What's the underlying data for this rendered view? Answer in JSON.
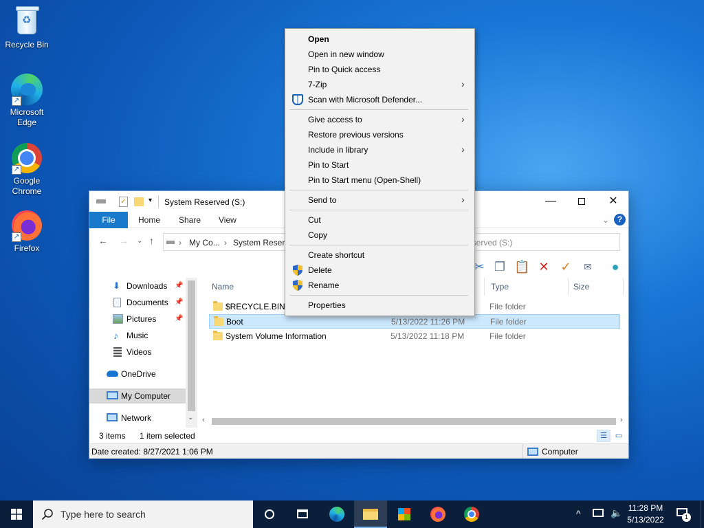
{
  "desktop": {
    "icons": [
      {
        "label": "Recycle Bin"
      },
      {
        "label": "Microsoft Edge"
      },
      {
        "label": "Google Chrome"
      },
      {
        "label": "Firefox"
      }
    ]
  },
  "explorer": {
    "title": "System Reserved (S:)",
    "ribbon_tabs": [
      "File",
      "Home",
      "Share",
      "View"
    ],
    "address": {
      "crumb_1": "My Co...",
      "crumb_2": "System Reserv",
      "search_text": "eserved (S:)"
    },
    "nav_items": [
      {
        "label": "Downloads",
        "pinned": true
      },
      {
        "label": "Documents",
        "pinned": true
      },
      {
        "label": "Pictures",
        "pinned": true
      },
      {
        "label": "Music",
        "pinned": false
      },
      {
        "label": "Videos",
        "pinned": false
      },
      {
        "label": "OneDrive",
        "pinned": false
      },
      {
        "label": "My Computer",
        "pinned": false
      },
      {
        "label": "Network",
        "pinned": false
      }
    ],
    "columns": {
      "name": "Name",
      "type": "Type",
      "size": "Size"
    },
    "files": [
      {
        "name": "$RECYCLE.BIN",
        "date": "",
        "type": "File folder",
        "selected": false
      },
      {
        "name": "Boot",
        "date": "5/13/2022 11:26 PM",
        "type": "File folder",
        "selected": true
      },
      {
        "name": "System Volume Information",
        "date": "5/13/2022 11:18 PM",
        "type": "File folder",
        "selected": false
      }
    ],
    "status": {
      "count": "3 items",
      "selected": "1 item selected"
    },
    "details": {
      "date_created": "Date created: 8/27/2021 1:06 PM",
      "location": "Computer"
    }
  },
  "context_menu": {
    "items": [
      {
        "label": "Open",
        "bold": true
      },
      {
        "label": "Open in new window"
      },
      {
        "label": "Pin to Quick access"
      },
      {
        "label": "7-Zip",
        "submenu": true
      },
      {
        "label": "Scan with Microsoft Defender...",
        "icon": "defender-icon"
      },
      {
        "label": "Give access to",
        "submenu": true
      },
      {
        "label": "Restore previous versions"
      },
      {
        "label": "Include in library",
        "submenu": true
      },
      {
        "label": "Pin to Start"
      },
      {
        "label": "Pin to Start menu (Open-Shell)"
      },
      {
        "label": "Send to",
        "submenu": true
      },
      {
        "label": "Cut"
      },
      {
        "label": "Copy"
      },
      {
        "label": "Create shortcut"
      },
      {
        "label": "Delete",
        "icon": "uac-shield-icon"
      },
      {
        "label": "Rename",
        "icon": "uac-shield-icon"
      },
      {
        "label": "Properties"
      }
    ]
  },
  "taskbar": {
    "search_placeholder": "Type here to search",
    "time": "11:28 PM",
    "date": "5/13/2022",
    "notification_count": "1"
  },
  "colors": {
    "accent": "#1979ca",
    "selection": "#cce8ff",
    "taskbar": "#0c1f3a"
  }
}
